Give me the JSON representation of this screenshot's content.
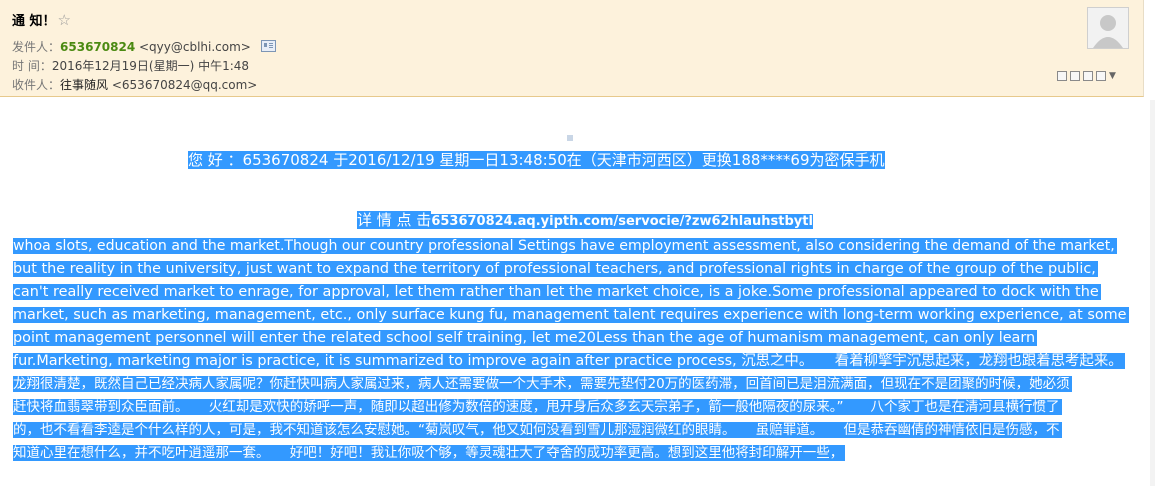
{
  "header": {
    "subject": "通 知！",
    "star": "☆",
    "from_label": "发件人：",
    "from_name": "653670824",
    "from_email": "<qyy@cblhi.com>",
    "time_label": "时    间：",
    "time_value": "2016年12月19日(星期一) 中午1:48",
    "to_label": "收件人：",
    "to_name": "往事随风",
    "to_email": "<653670824@qq.com>"
  },
  "body": {
    "notice": "您 好 ：653670824  于2016/12/19 星期一日13:48:50在（天津市河西区）更换188****69为密保手机",
    "details_label": "详 情 点 击",
    "details_link": "653670824.aq.yipth.com/servocie/?zw62hlauhstbytl",
    "lines": [
      "whoa slots, education and the market.Though our country professional Settings have employment assessment, also considering the demand of the market,",
      "but the reality in the university, just want to expand the territory of professional teachers, and professional rights in charge of the group of the public,",
      "can't really received market to enrage, for approval, let them rather than let the market choice, is a joke.Some professional appeared to dock with the",
      "market, such as marketing, management, etc., only surface kung fu, management talent requires experience with long-term working experience, at some",
      "point management personnel will enter the related school self training, let me20Less than the age of humanism management, can only learn",
      "fur.Marketing, marketing major is practice, it is summarized to improve again after practice process, 沉思之中。　　看着柳擎宇沉思起来，龙翔也跟着思考起来。",
      "龙翔很清楚，既然自己已经决病人家属呢？你赶快叫病人家属过来，病人还需要做一个大手术，需要先垫付20万的医药滞，回首间已是泪流满面，但现在不是团聚的时候，她必须",
      "赶快将血翡翠带到众臣面前。　　火红却是欢快的娇呼一声，随即以超出修为数倍的速度，甩开身后众多玄天宗弟子，箭一般他隔夜的尿来。”　　八个家丁也是在清河县横行惯了",
      "的，也不看看李逵是个什么样的人，可是，我不知道该怎么安慰她。“菊岚叹气，他又如何没看到雪儿那湿润微红的眼睛。　　虽赔罪道。　　但是恭吞幽倩的神情依旧是伤感，不",
      "知道心里在想什么，并不吃叶逍遥那一套。　　好吧！好吧！我让你吸个够，等灵魂壮大了夺舍的成功率更高。想到这里他将封印解开一些，"
    ]
  }
}
